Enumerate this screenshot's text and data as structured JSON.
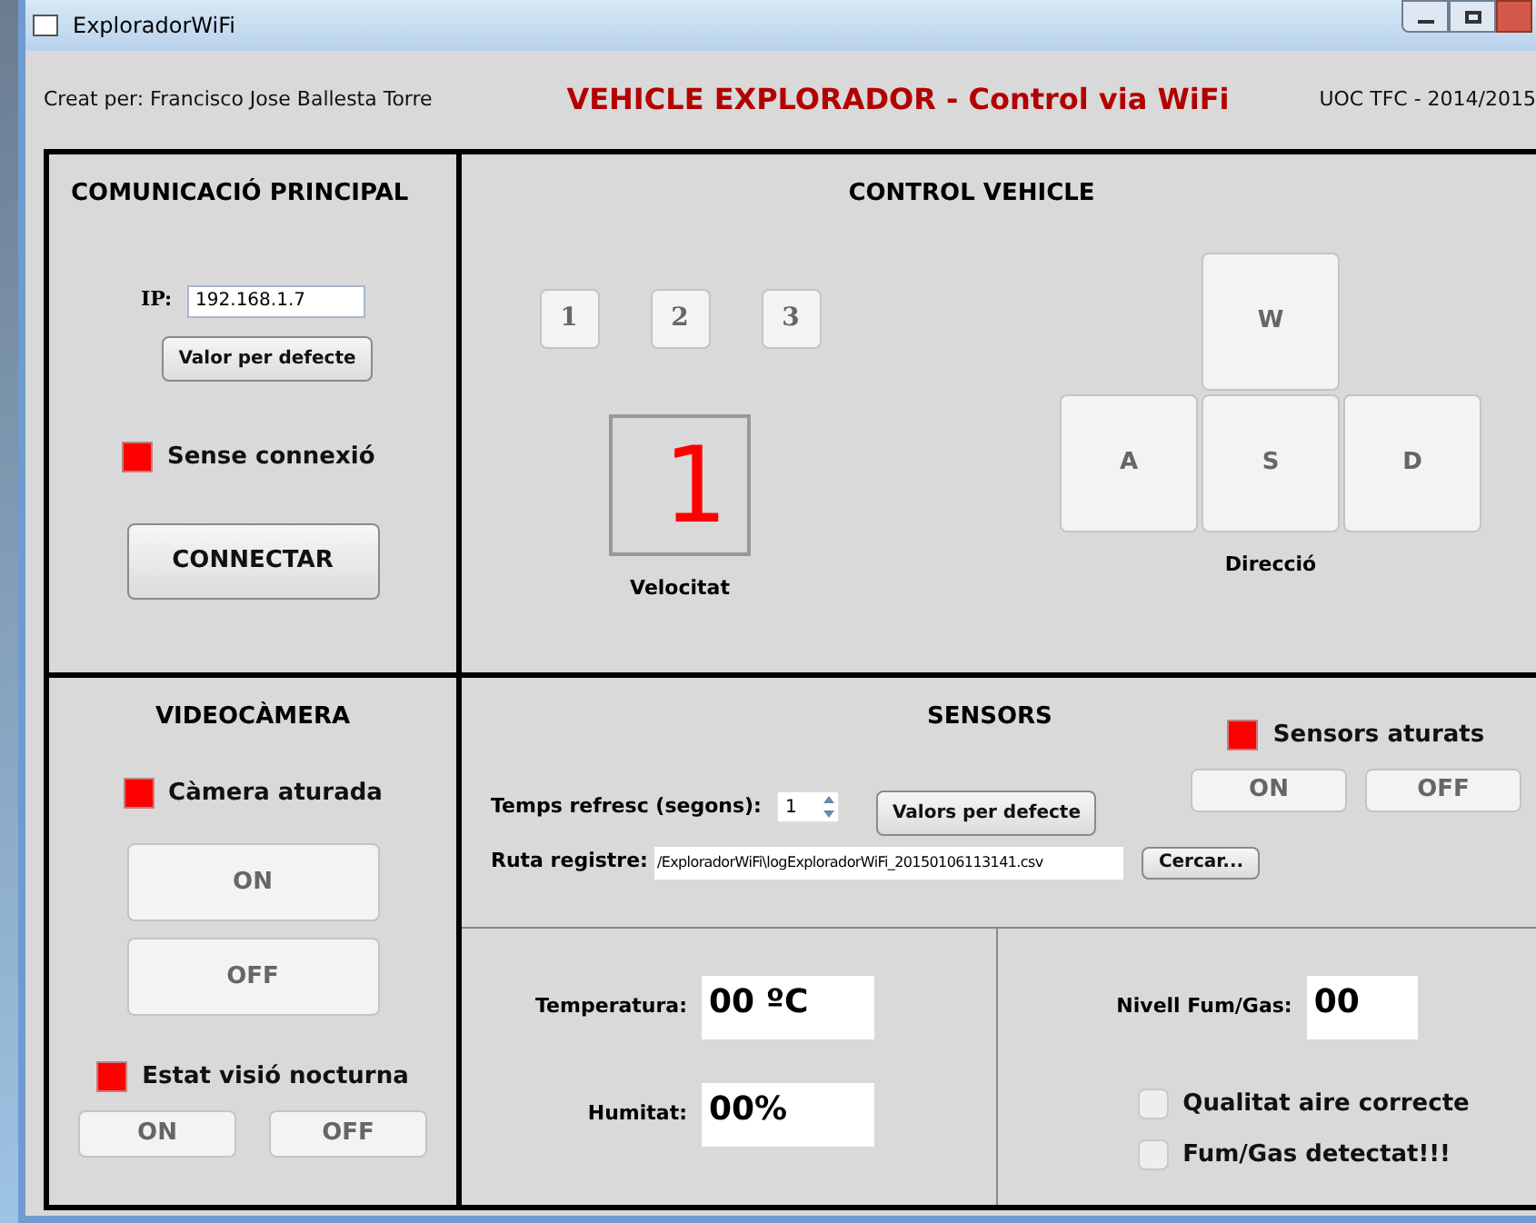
{
  "window": {
    "title": "ExploradorWiFi"
  },
  "header": {
    "author": "Creat per: Francisco Jose Ballesta Torre",
    "title": "VEHICLE EXPLORADOR - Control via WiFi",
    "course": "UOC TFC - 2014/2015"
  },
  "communication": {
    "title": "COMUNICACIÓ PRINCIPAL",
    "ip_label": "IP:",
    "ip_value": "192.168.1.7",
    "default_button": "Valor per defecte",
    "status": {
      "label": "Sense connexió",
      "on": true
    },
    "connect_button": "CONNECTAR"
  },
  "control": {
    "title": "CONTROL VEHICLE",
    "speed_buttons": [
      "1",
      "2",
      "3"
    ],
    "speed_display": "1",
    "speed_label": "Velocitat",
    "keys": {
      "up": "W",
      "left": "A",
      "down": "S",
      "right": "D"
    },
    "direction_label": "Direcció"
  },
  "camera": {
    "title": "VIDEOCÀMERA",
    "status": {
      "label": "Càmera aturada",
      "on": true
    },
    "on_button": "ON",
    "off_button": "OFF",
    "night": {
      "label": "Estat visió nocturna",
      "on": true
    },
    "night_on_button": "ON",
    "night_off_button": "OFF"
  },
  "sensors": {
    "title": "SENSORS",
    "status": {
      "label": "Sensors aturats",
      "on": true
    },
    "on_button": "ON",
    "off_button": "OFF",
    "refresh_label": "Temps refresc (segons):",
    "refresh_value": "1",
    "defaults_button": "Valors per defecte",
    "log_label": "Ruta registre:",
    "log_path": "/ExploradorWiFi\\logExploradorWiFi_20150106113141.csv",
    "browse_button": "Cercar..."
  },
  "climate": {
    "temperature_label": "Temperatura:",
    "temperature_value": "00 ºC",
    "humidity_label": "Humitat:",
    "humidity_value": "00%"
  },
  "gas": {
    "level_label": "Nivell Fum/Gas:",
    "level_value": "00",
    "indicators": [
      {
        "label": "Qualitat aire correcte",
        "on": false
      },
      {
        "label": "Fum/Gas detectat!!!",
        "on": false
      }
    ]
  }
}
